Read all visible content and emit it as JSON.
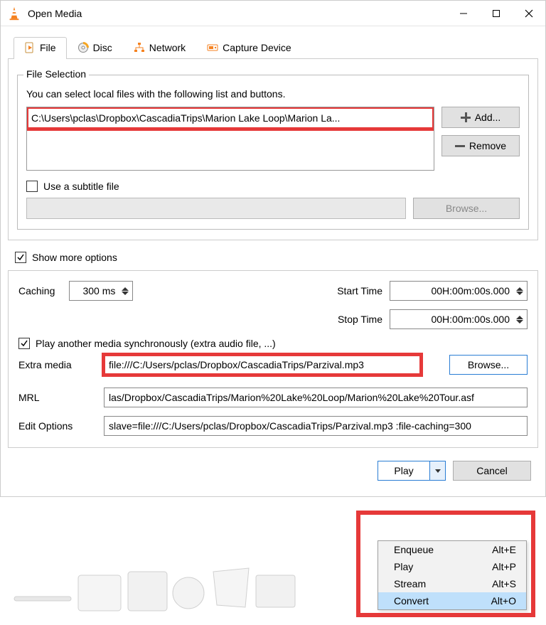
{
  "window": {
    "title": "Open Media"
  },
  "tabs": {
    "file": "File",
    "disc": "Disc",
    "network": "Network",
    "capture": "Capture Device"
  },
  "file_section": {
    "legend": "File Selection",
    "help": "You can select local files with the following list and buttons.",
    "selected_path": "C:\\Users\\pclas\\Dropbox\\CascadiaTrips\\Marion Lake Loop\\Marion La...",
    "add_label": "Add...",
    "remove_label": "Remove",
    "subtitle_check_label": "Use a subtitle file",
    "subtitle_browse": "Browse..."
  },
  "show_more_label": "Show more options",
  "options": {
    "caching_label": "Caching",
    "caching_value": "300 ms",
    "start_label": "Start Time",
    "start_value": "00H:00m:00s.000",
    "stop_label": "Stop Time",
    "stop_value": "00H:00m:00s.000",
    "sync_label": "Play another media synchronously (extra audio file, ...)",
    "extra_label": "Extra media",
    "extra_value": "file:///C:/Users/pclas/Dropbox/CascadiaTrips/Parzival.mp3",
    "extra_browse": "Browse...",
    "mrl_label": "MRL",
    "mrl_value": "las/Dropbox/CascadiaTrips/Marion%20Lake%20Loop/Marion%20Lake%20Tour.asf",
    "edit_label": "Edit Options",
    "edit_value": "slave=file:///C:/Users/pclas/Dropbox/CascadiaTrips/Parzival.mp3 :file-caching=300"
  },
  "buttons": {
    "play": "Play",
    "cancel": "Cancel"
  },
  "menu": {
    "items": [
      {
        "label": "Enqueue",
        "accel": "Alt+E"
      },
      {
        "label": "Play",
        "accel": "Alt+P"
      },
      {
        "label": "Stream",
        "accel": "Alt+S"
      },
      {
        "label": "Convert",
        "accel": "Alt+O"
      }
    ],
    "highlighted": "Convert"
  }
}
